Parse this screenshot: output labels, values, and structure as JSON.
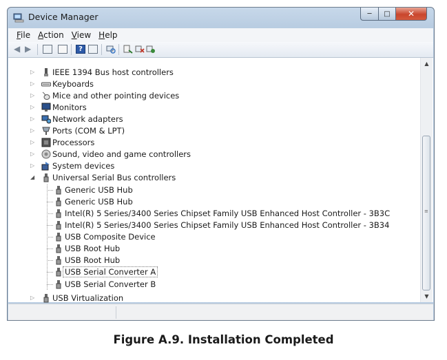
{
  "window": {
    "title": "Device Manager",
    "title_icon": "device-manager-icon",
    "controls": {
      "minimize": "minimize-icon",
      "maximize": "maximize-icon",
      "close": "close-icon"
    }
  },
  "menubar": {
    "items": [
      {
        "key": "F",
        "rest": "ile"
      },
      {
        "key": "A",
        "rest": "ction"
      },
      {
        "key": "V",
        "rest": "iew"
      },
      {
        "key": "H",
        "rest": "elp"
      }
    ]
  },
  "toolbar": {
    "buttons": [
      "back-icon",
      "forward-icon",
      "properties-icon",
      "details-icon",
      "help-icon",
      "show-hidden-icon",
      "scan-changes-icon",
      "update-driver-icon",
      "disable-icon",
      "uninstall-icon"
    ]
  },
  "tree": {
    "categories": [
      {
        "label": "IEEE 1394 Bus host controllers",
        "icon": "ieee1394-icon",
        "expanded": false
      },
      {
        "label": "Keyboards",
        "icon": "keyboard-icon",
        "expanded": false
      },
      {
        "label": "Mice and other pointing devices",
        "icon": "mouse-icon",
        "expanded": false
      },
      {
        "label": "Monitors",
        "icon": "monitor-icon",
        "expanded": false
      },
      {
        "label": "Network adapters",
        "icon": "network-adapter-icon",
        "expanded": false
      },
      {
        "label": "Ports (COM & LPT)",
        "icon": "port-icon",
        "expanded": false
      },
      {
        "label": "Processors",
        "icon": "processor-icon",
        "expanded": false
      },
      {
        "label": "Sound, video and game controllers",
        "icon": "speaker-icon",
        "expanded": false
      },
      {
        "label": "System devices",
        "icon": "system-devices-icon",
        "expanded": false
      },
      {
        "label": "Universal Serial Bus controllers",
        "icon": "usb-icon",
        "expanded": true
      }
    ],
    "usb_children": [
      {
        "label": "Generic USB Hub"
      },
      {
        "label": "Generic USB Hub"
      },
      {
        "label": "Intel(R) 5 Series/3400 Series Chipset Family USB Enhanced Host Controller - 3B3C"
      },
      {
        "label": "Intel(R) 5 Series/3400 Series Chipset Family USB Enhanced Host Controller - 3B34"
      },
      {
        "label": "USB Composite Device"
      },
      {
        "label": "USB Root Hub"
      },
      {
        "label": "USB Root Hub"
      },
      {
        "label": "USB Serial Converter A",
        "selected": true
      },
      {
        "label": "USB Serial Converter B"
      }
    ],
    "after": [
      {
        "label": "USB Virtualization",
        "icon": "usb-icon",
        "expanded": false
      }
    ]
  },
  "caption": "Figure A.9. Installation Completed"
}
